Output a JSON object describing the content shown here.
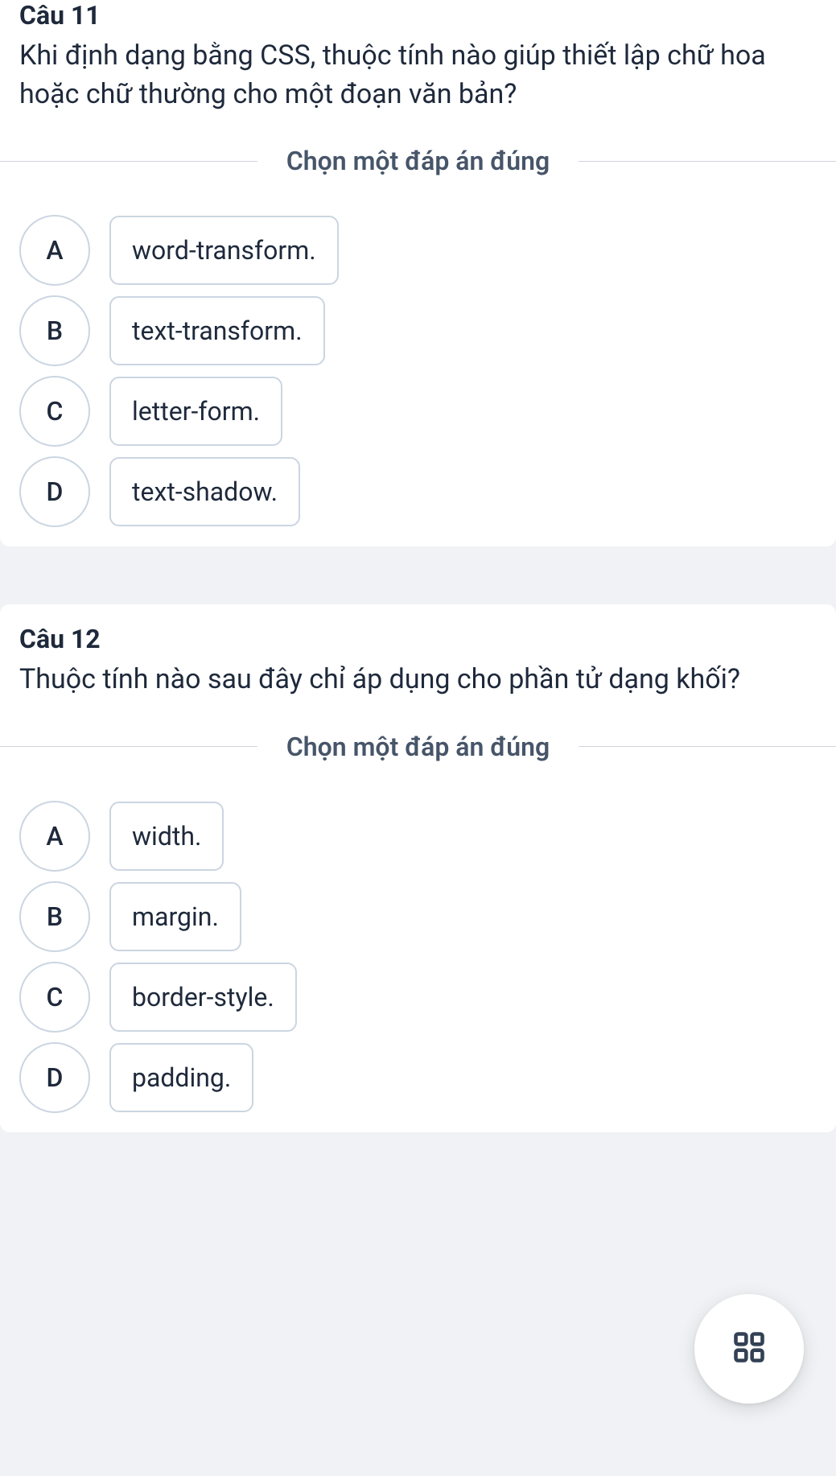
{
  "questions": [
    {
      "number": "Câu 11",
      "text": "Khi định dạng bằng CSS, thuộc tính nào giúp thiết lập chữ hoa hoặc chữ thường cho một đoạn văn bản?",
      "instruction": "Chọn một đáp án đúng",
      "options": [
        {
          "letter": "A",
          "text": "word-transform."
        },
        {
          "letter": "B",
          "text": "text-transform."
        },
        {
          "letter": "C",
          "text": "letter-form."
        },
        {
          "letter": "D",
          "text": "text-shadow."
        }
      ]
    },
    {
      "number": "Câu 12",
      "text": "Thuộc tính nào sau đây chỉ áp dụng cho phần tử dạng khối?",
      "instruction": "Chọn một đáp án đúng",
      "options": [
        {
          "letter": "A",
          "text": "width."
        },
        {
          "letter": "B",
          "text": "margin."
        },
        {
          "letter": "C",
          "text": "border-style."
        },
        {
          "letter": "D",
          "text": "padding."
        }
      ]
    }
  ]
}
